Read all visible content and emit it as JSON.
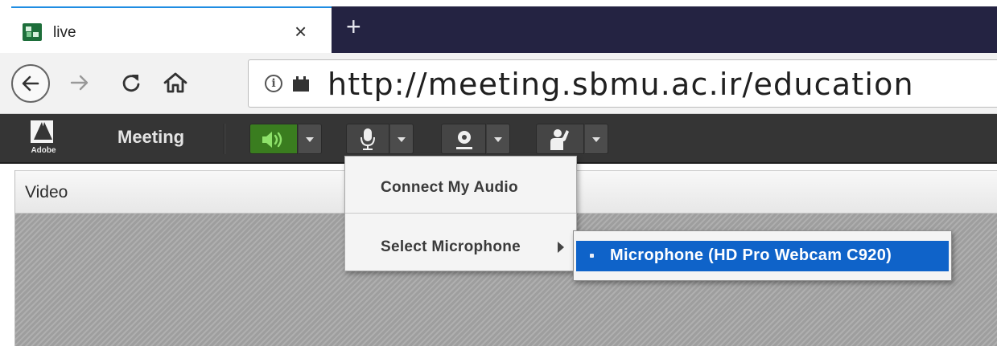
{
  "browser": {
    "tab": {
      "title": "live",
      "favicon": "adobe-connect-favicon-icon",
      "close": "×"
    },
    "new_tab": "+",
    "nav": {
      "back_icon": "arrow-left-icon",
      "forward_icon": "arrow-right-icon",
      "reload_icon": "reload-icon",
      "home_icon": "home-icon"
    },
    "address": {
      "info_icon": "ⓘ",
      "url": "http://meeting.sbmu.ac.ir/education"
    }
  },
  "appbar": {
    "logo_text": "Adobe",
    "meeting_menu": "Meeting",
    "controls": [
      {
        "name": "speaker",
        "icon": "speaker-icon",
        "active": true,
        "active_color": "#3a7d1f"
      },
      {
        "name": "microphone",
        "icon": "microphone-icon",
        "active": false
      },
      {
        "name": "webcam",
        "icon": "webcam-icon",
        "active": false
      },
      {
        "name": "status",
        "icon": "raise-hand-icon",
        "active": false
      }
    ]
  },
  "pod": {
    "title": "Video"
  },
  "mic_menu": {
    "items": [
      {
        "label": "Connect My Audio"
      },
      {
        "label": "Select Microphone",
        "has_submenu": true
      }
    ],
    "submenu": {
      "items": [
        {
          "label": "Microphone (HD Pro Webcam C920)",
          "selected": true
        }
      ],
      "highlight_color": "#0f63c9"
    }
  }
}
